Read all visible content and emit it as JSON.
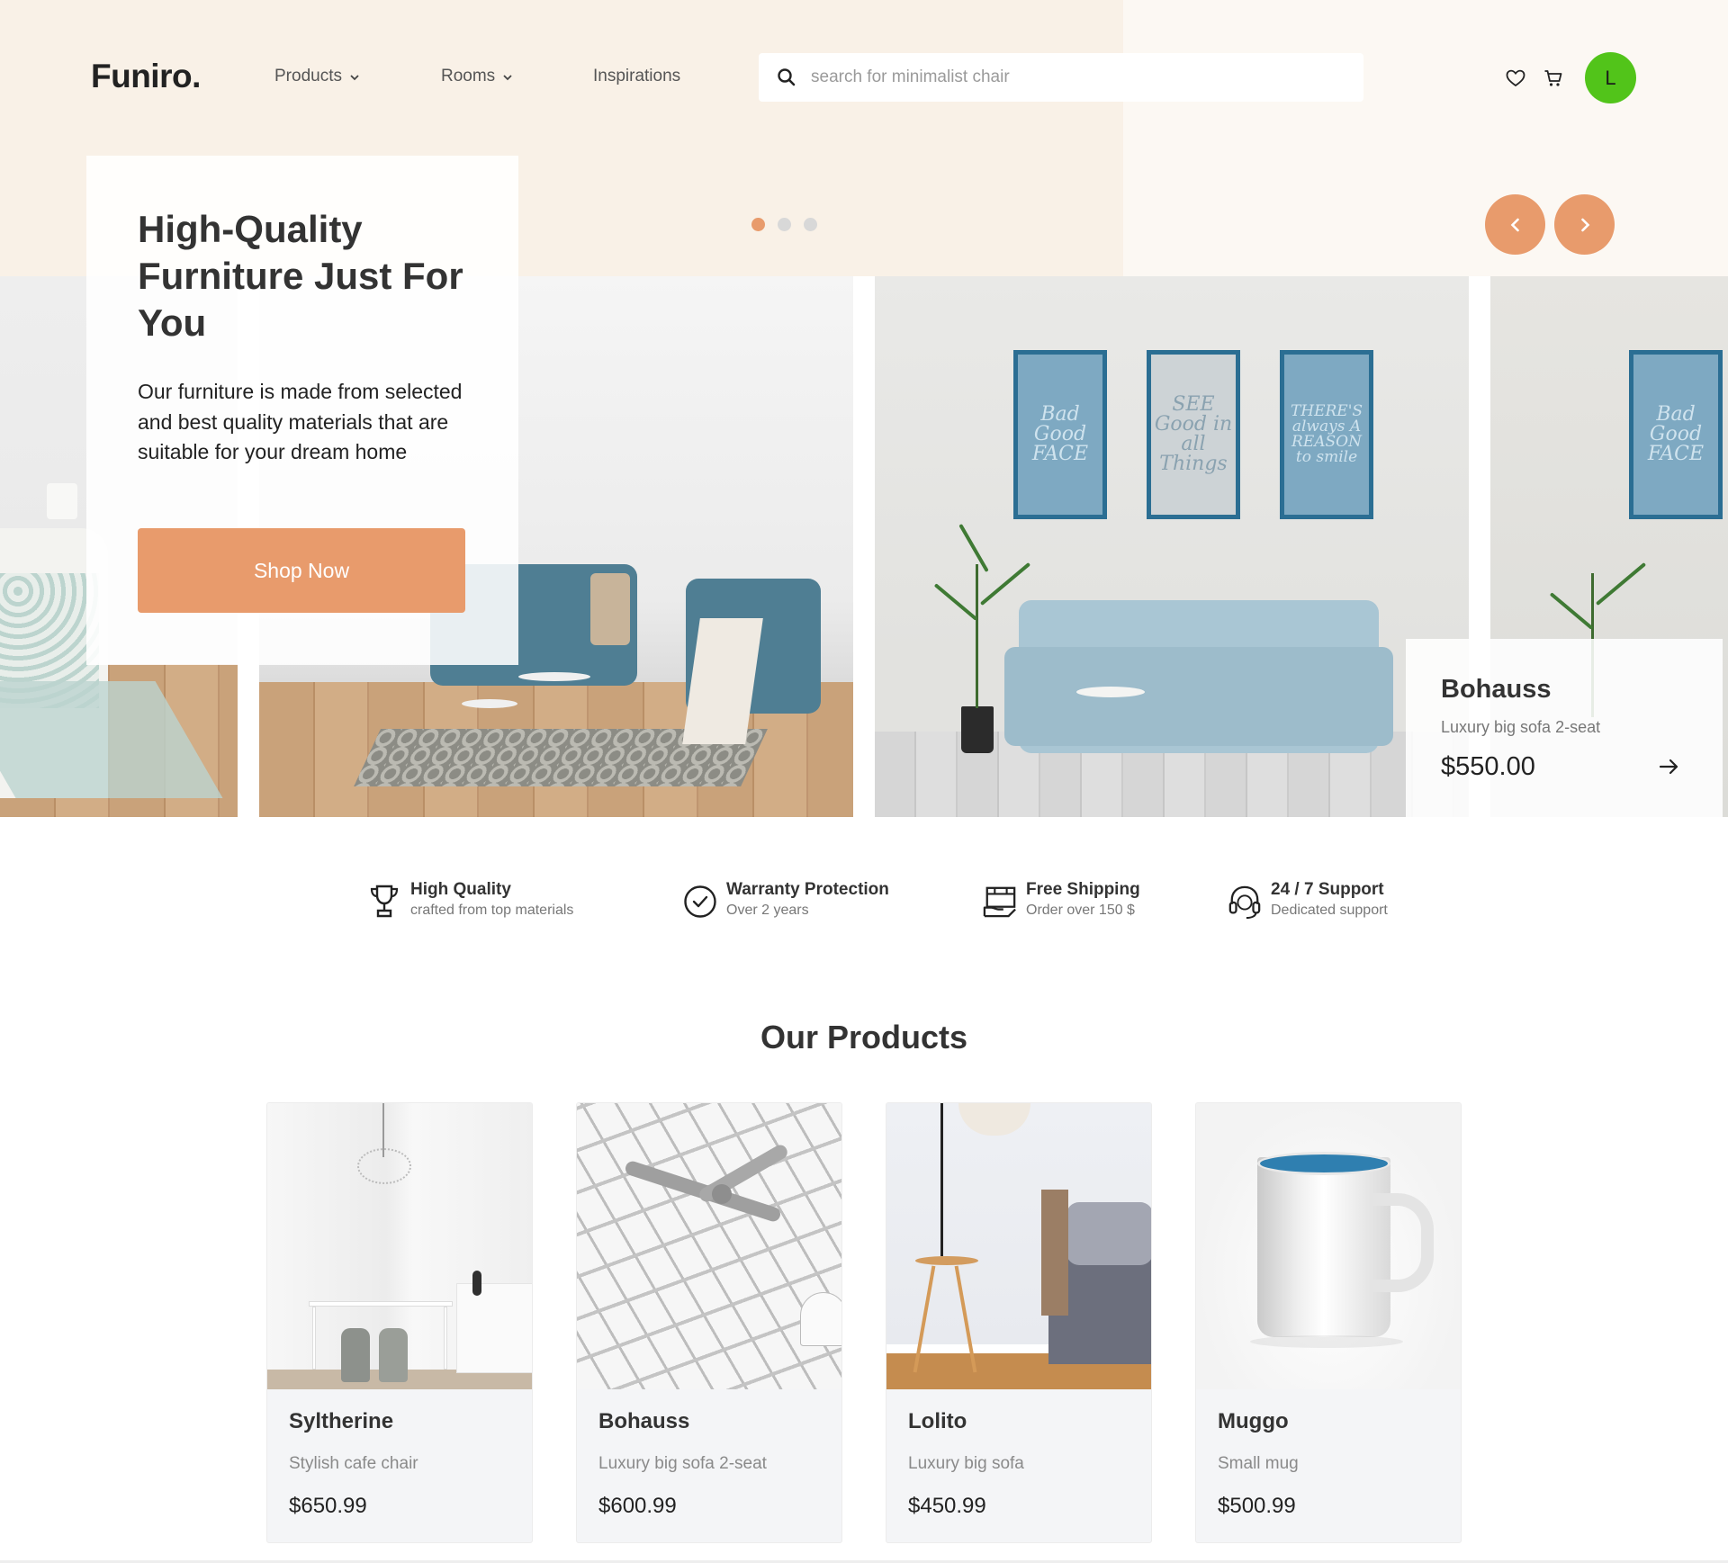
{
  "brand": {
    "logo": "Funiro."
  },
  "nav": {
    "items": [
      {
        "label": "Products",
        "has_dropdown": true
      },
      {
        "label": "Rooms",
        "has_dropdown": true
      },
      {
        "label": "Inspirations",
        "has_dropdown": false
      }
    ]
  },
  "search": {
    "placeholder": "search for minimalist chair",
    "icon": "search-icon"
  },
  "header_icons": {
    "wishlist": "heart-icon",
    "cart": "cart-icon"
  },
  "user": {
    "avatar_initial": "L",
    "avatar_color": "#52c41a"
  },
  "hero": {
    "title": "High-Quality Furniture Just For You",
    "text": "Our furniture is made from selected and best quality materials that are suitable for your dream home",
    "cta": "Shop Now",
    "slide_count": 3,
    "active_slide": 1
  },
  "carousel": {
    "prev_icon": "chevron-left-icon",
    "next_icon": "chevron-right-icon"
  },
  "frames": [
    "Bad Good FACE",
    "SEE Good in all Things",
    "THERE'S always A REASON to smile"
  ],
  "featured": {
    "name": "Bohauss",
    "description": "Luxury big sofa 2-seat",
    "price": "$550.00",
    "arrow_icon": "arrow-right-icon"
  },
  "features": [
    {
      "icon": "trophy-icon",
      "title": "High Quality",
      "subtitle": "crafted from top materials"
    },
    {
      "icon": "badge-check-icon",
      "title": "Warranty Protection",
      "subtitle": "Over 2 years"
    },
    {
      "icon": "shipping-box-icon",
      "title": "Free Shipping",
      "subtitle": "Order over 150 $"
    },
    {
      "icon": "headset-icon",
      "title": "24 / 7 Support",
      "subtitle": "Dedicated support"
    }
  ],
  "products": {
    "title": "Our Products",
    "items": [
      {
        "name": "Syltherine",
        "description": "Stylish cafe chair",
        "price": "$650.99"
      },
      {
        "name": "Bohauss",
        "description": "Luxury big sofa 2-seat",
        "price": "$600.99"
      },
      {
        "name": "Lolito",
        "description": "Luxury big sofa",
        "price": "$450.99"
      },
      {
        "name": "Muggo",
        "description": "Small mug",
        "price": "$500.99"
      }
    ]
  },
  "colors": {
    "accent": "#e89b6c",
    "top_bg": "#f9f1e7",
    "top_bg_right": "#fcf8f3",
    "text": "#333333"
  }
}
